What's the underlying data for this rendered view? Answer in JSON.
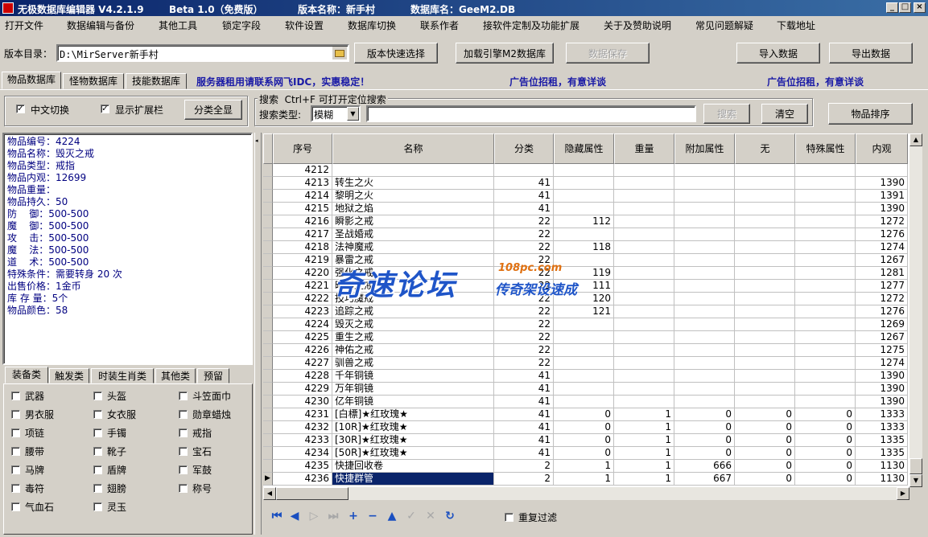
{
  "titlebar": {
    "app_title": "无极数据库编辑器 V4.2.1.9",
    "beta": "Beta 1.0（免费版）",
    "version_name": "版本名称：新手村",
    "db_name": "数据库名：GeeM2.DB",
    "minimize": "_",
    "maximize": "□",
    "close": "×"
  },
  "menu": [
    "打开文件",
    "数据编辑与备份",
    "其他工具",
    "锁定字段",
    "软件设置",
    "数据库切换",
    "联系作者",
    "接软件定制及功能扩展",
    "关于及赞助说明",
    "常见问题解疑",
    "下载地址"
  ],
  "toolbar": {
    "dir_label": "版本目录：",
    "dir_value": "D:\\MirServer新手村",
    "quick_select": "版本快速选择",
    "load_engine": "加载引擎M2数据库",
    "save_data": "数据保存",
    "import": "导入数据",
    "export": "导出数据"
  },
  "tabs": [
    "物品数据库",
    "怪物数据库",
    "技能数据库"
  ],
  "ads": {
    "server": "服务器租用请联系网飞IDC，实惠稳定！",
    "ad1": "广告位招租，有意详谈",
    "ad2": "广告位招租，有意详谈"
  },
  "options": {
    "chinese_switch": "中文切换",
    "show_ext": "显示扩展栏",
    "show_all": "分类全显"
  },
  "search": {
    "group_title": "搜索  Ctrl+F 可打开定位搜索",
    "type_label": "搜索类型:",
    "type_value": "模糊",
    "search_btn": "搜索",
    "clear_btn": "清空",
    "sort_btn": "物品排序",
    "query": ""
  },
  "item_info": [
    "物品编号：4224",
    "物品名称：毁灭之戒",
    "物品类型：戒指",
    "物品内观：12699",
    "物品重量：",
    "物品持久：50",
    "防    御：500-500",
    "魔    御：500-500",
    "攻    击：500-500",
    "魔    法：500-500",
    "道    术：500-500",
    "特殊条件：需要转身 20 次",
    "出售价格：1金币",
    "库 存 量：5个",
    "物品颜色：58"
  ],
  "category_tabs": [
    "装备类",
    "触发类",
    "时装生肖类",
    "其他类",
    "预留"
  ],
  "categories": [
    [
      "武器",
      "头盔",
      "斗笠面巾"
    ],
    [
      "男衣服",
      "女衣服",
      "勋章蜡烛"
    ],
    [
      "项链",
      "手镯",
      "戒指"
    ],
    [
      "腰带",
      "靴子",
      "宝石"
    ],
    [
      "马牌",
      "盾牌",
      "军鼓"
    ],
    [
      "毒符",
      "翅膀",
      "称号"
    ],
    [
      "气血石",
      "灵玉",
      ""
    ]
  ],
  "grid": {
    "columns": [
      "序号",
      "名称",
      "分类",
      "隐藏属性",
      "重量",
      "附加属性",
      "无",
      "特殊属性",
      "内观"
    ],
    "rows": [
      [
        "4212",
        "",
        "",
        "",
        "",
        "",
        "",
        "",
        ""
      ],
      [
        "4213",
        "转生之火",
        "41",
        "",
        "",
        "",
        "",
        "",
        "1390"
      ],
      [
        "4214",
        "黎明之火",
        "41",
        "",
        "",
        "",
        "",
        "",
        "1391"
      ],
      [
        "4215",
        "地狱之焰",
        "41",
        "",
        "",
        "",
        "",
        "",
        "1390"
      ],
      [
        "4216",
        "瞬影之戒",
        "22",
        "112",
        "",
        "",
        "",
        "",
        "1272"
      ],
      [
        "4217",
        "圣战婚戒",
        "22",
        "",
        "",
        "",
        "",
        "",
        "1276"
      ],
      [
        "4218",
        "法神魔戒",
        "22",
        "118",
        "",
        "",
        "",
        "",
        "1274"
      ],
      [
        "4219",
        "暴雷之戒",
        "22",
        "",
        "",
        "",
        "",
        "",
        "1267"
      ],
      [
        "4220",
        "强化之戒",
        "22",
        "119",
        "",
        "",
        "",
        "",
        "1281"
      ],
      [
        "4221",
        "暗影之戒",
        "22",
        "111",
        "",
        "",
        "",
        "",
        "1277"
      ],
      [
        "4222",
        "技巧魔戒",
        "22",
        "120",
        "",
        "",
        "",
        "",
        "1272"
      ],
      [
        "4223",
        "追踪之戒",
        "22",
        "121",
        "",
        "",
        "",
        "",
        "1276"
      ],
      [
        "4224",
        "毁灭之戒",
        "22",
        "",
        "",
        "",
        "",
        "",
        "1269"
      ],
      [
        "4225",
        "重生之戒",
        "22",
        "",
        "",
        "",
        "",
        "",
        "1267"
      ],
      [
        "4226",
        "神佑之戒",
        "22",
        "",
        "",
        "",
        "",
        "",
        "1275"
      ],
      [
        "4227",
        "驯兽之戒",
        "22",
        "",
        "",
        "",
        "",
        "",
        "1274"
      ],
      [
        "4228",
        "千年铜镜",
        "41",
        "",
        "",
        "",
        "",
        "",
        "1390"
      ],
      [
        "4229",
        "万年铜镜",
        "41",
        "",
        "",
        "",
        "",
        "",
        "1390"
      ],
      [
        "4230",
        "亿年铜镜",
        "41",
        "",
        "",
        "",
        "",
        "",
        "1390"
      ],
      [
        "4231",
        "[白標]★红玫瑰★",
        "41",
        "0",
        "1",
        "0",
        "0",
        "0",
        "1333"
      ],
      [
        "4232",
        "[10R]★红玫瑰★",
        "41",
        "0",
        "1",
        "0",
        "0",
        "0",
        "1333"
      ],
      [
        "4233",
        "[30R]★红玫瑰★",
        "41",
        "0",
        "1",
        "0",
        "0",
        "0",
        "1335"
      ],
      [
        "4234",
        "[50R]★红玫瑰★",
        "41",
        "0",
        "1",
        "0",
        "0",
        "0",
        "1335"
      ],
      [
        "4235",
        "快捷回收卷",
        "2",
        "1",
        "1",
        "666",
        "0",
        "0",
        "1130"
      ],
      [
        "4236",
        "快捷群管",
        "2",
        "1",
        "1",
        "667",
        "0",
        "0",
        "1130"
      ]
    ],
    "selected_index": 24
  },
  "bottom": {
    "dedupe_label": "重复过滤"
  },
  "watermark": {
    "main": "奇速论坛",
    "domain": "108pc.com",
    "slogan": "传奇架设速成"
  },
  "colors": {
    "title_start": "#0a246a",
    "selection": "#0a246a",
    "ad_blue": "#1a1aa6",
    "info_text": "#000080"
  }
}
